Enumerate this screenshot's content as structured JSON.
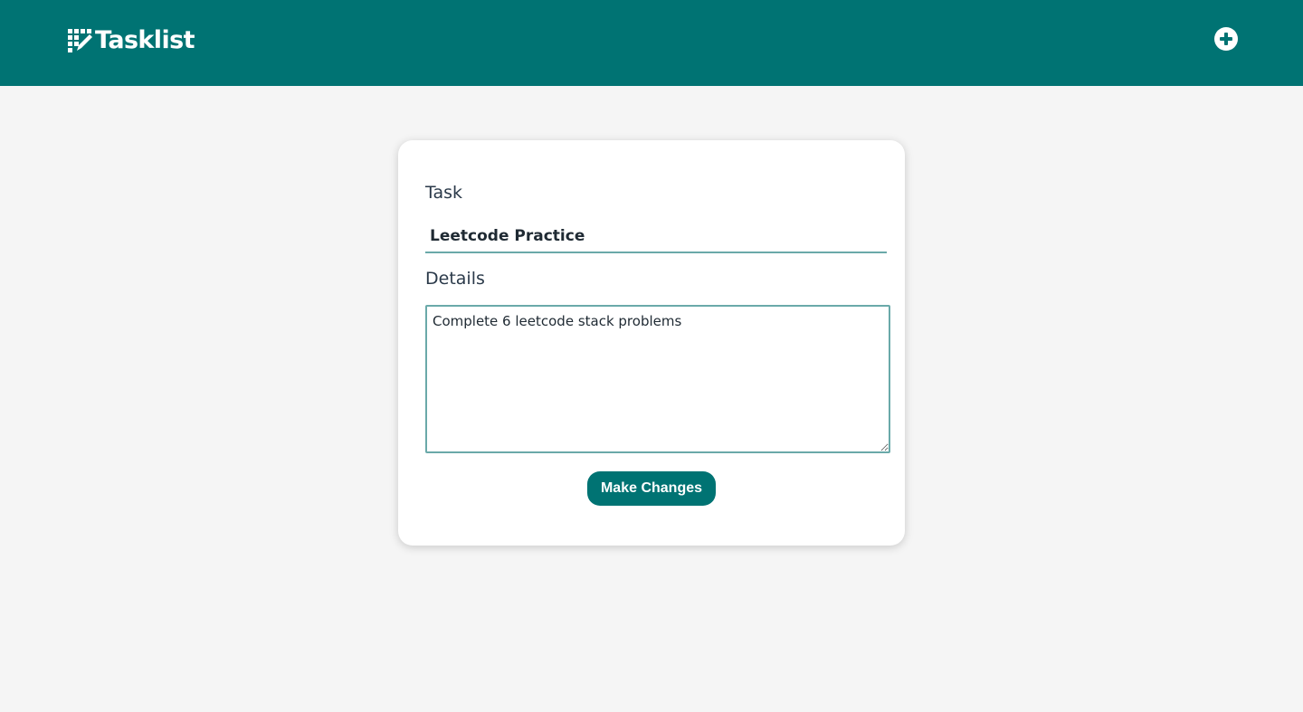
{
  "header": {
    "brand_title": "Tasklist",
    "brand_icon": "tasklist-logo-icon",
    "add_icon": "plus-circle-icon",
    "background_color": "#007373"
  },
  "form": {
    "task_label": "Task",
    "task_value": "Leetcode Practice",
    "details_label": "Details",
    "details_value": "Complete 6 leetcode stack problems",
    "submit_label": "Make Changes",
    "accent_color": "#007373"
  }
}
